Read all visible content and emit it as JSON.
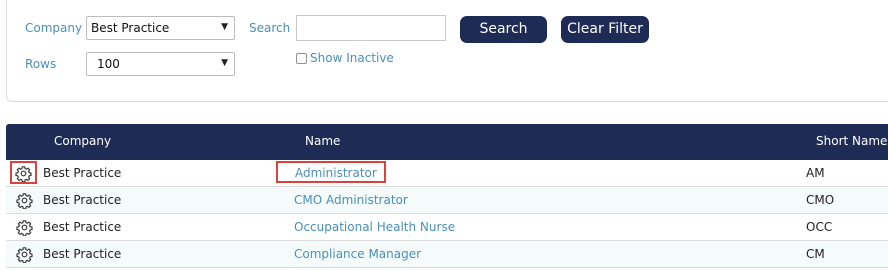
{
  "filters": {
    "company_label": "Company",
    "company_value": "Best Practice",
    "search_label": "Search",
    "search_value": "",
    "search_button": "Search",
    "clear_button": "Clear Filter",
    "rows_label": "Rows",
    "rows_value": "100",
    "show_inactive_label": "Show Inactive",
    "show_inactive_checked": false
  },
  "table": {
    "columns": [
      "Company",
      "Name",
      "Short Name"
    ],
    "rows": [
      {
        "company": "Best Practice",
        "name": "Administrator",
        "short": "AM"
      },
      {
        "company": "Best Practice",
        "name": "CMO Administrator",
        "short": "CMO"
      },
      {
        "company": "Best Practice",
        "name": "Occupational Health Nurse",
        "short": "OCC"
      },
      {
        "company": "Best Practice",
        "name": "Compliance Manager",
        "short": "CM"
      }
    ]
  },
  "colors": {
    "header_bg": "#1e2b55",
    "link": "#4a90b8",
    "highlight_border": "#d9433b"
  }
}
